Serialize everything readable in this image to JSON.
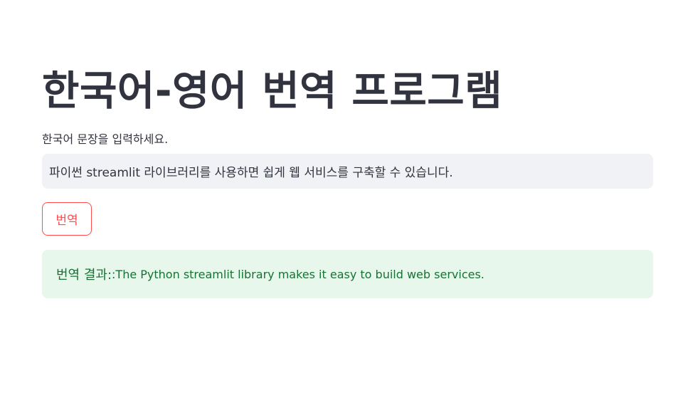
{
  "page": {
    "title": "한국어-영어 번역 프로그램"
  },
  "input": {
    "label": "한국어 문장을 입력하세요.",
    "value": "파이썬 streamlit 라이브러리를 사용하면 쉽게 웹 서비스를 구축할 수 있습니다."
  },
  "button": {
    "label": "번역"
  },
  "result": {
    "prefix": "번역 결과:",
    "text": ":The Python streamlit library makes it easy to build web services."
  },
  "colors": {
    "primary": "#ff4b4b",
    "success_bg": "#e8f7ec",
    "success_text": "#177233",
    "input_bg": "#f0f2f6",
    "text": "#31333f"
  }
}
